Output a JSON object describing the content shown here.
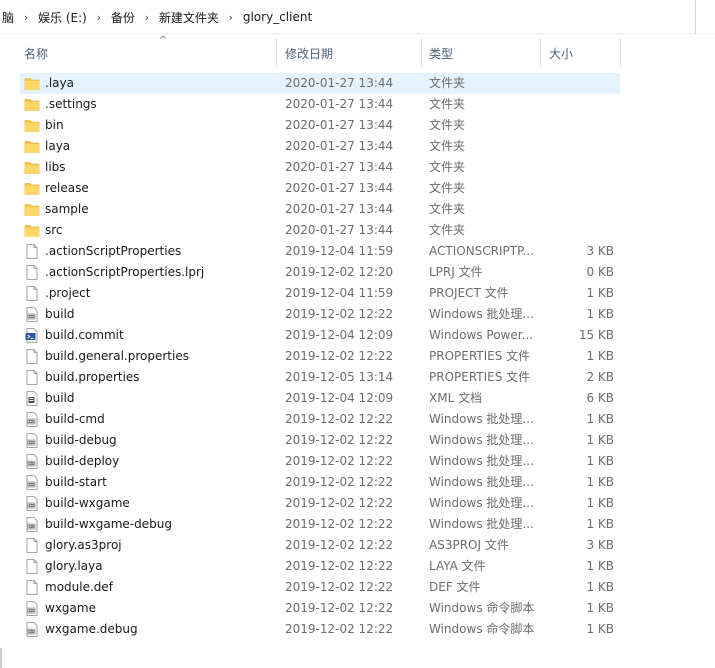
{
  "breadcrumb": [
    "脑",
    "娱乐 (E:)",
    "备份",
    "新建文件夹",
    "glory_client"
  ],
  "breadcrumb_separator": "›",
  "columns": {
    "name": "名称",
    "date": "修改日期",
    "type": "类型",
    "size": "大小",
    "sort_indicator": "^"
  },
  "files": [
    {
      "name": ".laya",
      "date": "2020-01-27 13:44",
      "type": "文件夹",
      "size": "",
      "icon": "folder-icon",
      "selected": true
    },
    {
      "name": ".settings",
      "date": "2020-01-27 13:44",
      "type": "文件夹",
      "size": "",
      "icon": "folder-icon"
    },
    {
      "name": "bin",
      "date": "2020-01-27 13:44",
      "type": "文件夹",
      "size": "",
      "icon": "folder-icon"
    },
    {
      "name": "laya",
      "date": "2020-01-27 13:44",
      "type": "文件夹",
      "size": "",
      "icon": "folder-icon"
    },
    {
      "name": "libs",
      "date": "2020-01-27 13:44",
      "type": "文件夹",
      "size": "",
      "icon": "folder-icon"
    },
    {
      "name": "release",
      "date": "2020-01-27 13:44",
      "type": "文件夹",
      "size": "",
      "icon": "folder-icon"
    },
    {
      "name": "sample",
      "date": "2020-01-27 13:44",
      "type": "文件夹",
      "size": "",
      "icon": "folder-icon"
    },
    {
      "name": "src",
      "date": "2020-01-27 13:44",
      "type": "文件夹",
      "size": "",
      "icon": "folder-icon"
    },
    {
      "name": ".actionScriptProperties",
      "date": "2019-12-04 11:59",
      "type": "ACTIONSCRIPTP...",
      "size": "3 KB",
      "icon": "file-icon"
    },
    {
      "name": ".actionScriptProperties.lprj",
      "date": "2019-12-02 12:20",
      "type": "LPRJ 文件",
      "size": "0 KB",
      "icon": "file-icon"
    },
    {
      "name": ".project",
      "date": "2019-12-04 11:59",
      "type": "PROJECT 文件",
      "size": "1 KB",
      "icon": "file-icon"
    },
    {
      "name": "build",
      "date": "2019-12-02 12:22",
      "type": "Windows 批处理...",
      "size": "1 KB",
      "icon": "batch-file-icon"
    },
    {
      "name": "build.commit",
      "date": "2019-12-04 12:09",
      "type": "Windows Power...",
      "size": "15 KB",
      "icon": "powershell-file-icon"
    },
    {
      "name": "build.general.properties",
      "date": "2019-12-02 12:22",
      "type": "PROPERTIES 文件",
      "size": "1 KB",
      "icon": "file-icon"
    },
    {
      "name": "build.properties",
      "date": "2019-12-05 13:14",
      "type": "PROPERTIES 文件",
      "size": "2 KB",
      "icon": "file-icon"
    },
    {
      "name": "build",
      "date": "2019-12-04 12:09",
      "type": "XML 文档",
      "size": "6 KB",
      "icon": "xml-file-icon"
    },
    {
      "name": "build-cmd",
      "date": "2019-12-02 12:22",
      "type": "Windows 批处理...",
      "size": "1 KB",
      "icon": "batch-file-icon"
    },
    {
      "name": "build-debug",
      "date": "2019-12-02 12:22",
      "type": "Windows 批处理...",
      "size": "1 KB",
      "icon": "batch-file-icon"
    },
    {
      "name": "build-deploy",
      "date": "2019-12-02 12:22",
      "type": "Windows 批处理...",
      "size": "1 KB",
      "icon": "batch-file-icon"
    },
    {
      "name": "build-start",
      "date": "2019-12-02 12:22",
      "type": "Windows 批处理...",
      "size": "1 KB",
      "icon": "batch-file-icon"
    },
    {
      "name": "build-wxgame",
      "date": "2019-12-02 12:22",
      "type": "Windows 批处理...",
      "size": "1 KB",
      "icon": "batch-file-icon"
    },
    {
      "name": "build-wxgame-debug",
      "date": "2019-12-02 12:22",
      "type": "Windows 批处理...",
      "size": "1 KB",
      "icon": "batch-file-icon"
    },
    {
      "name": "glory.as3proj",
      "date": "2019-12-02 12:22",
      "type": "AS3PROJ 文件",
      "size": "3 KB",
      "icon": "file-icon"
    },
    {
      "name": "glory.laya",
      "date": "2019-12-02 12:22",
      "type": "LAYA 文件",
      "size": "1 KB",
      "icon": "file-icon"
    },
    {
      "name": "module.def",
      "date": "2019-12-02 12:22",
      "type": "DEF 文件",
      "size": "1 KB",
      "icon": "file-icon"
    },
    {
      "name": "wxgame",
      "date": "2019-12-02 12:22",
      "type": "Windows 命令脚本",
      "size": "1 KB",
      "icon": "batch-file-icon"
    },
    {
      "name": "wxgame.debug",
      "date": "2019-12-02 12:22",
      "type": "Windows 命令脚本",
      "size": "1 KB",
      "icon": "batch-file-icon"
    }
  ],
  "colors": {
    "selection": "#e5f3ff",
    "folder": "#f5c648",
    "header_text": "#4c607a"
  }
}
